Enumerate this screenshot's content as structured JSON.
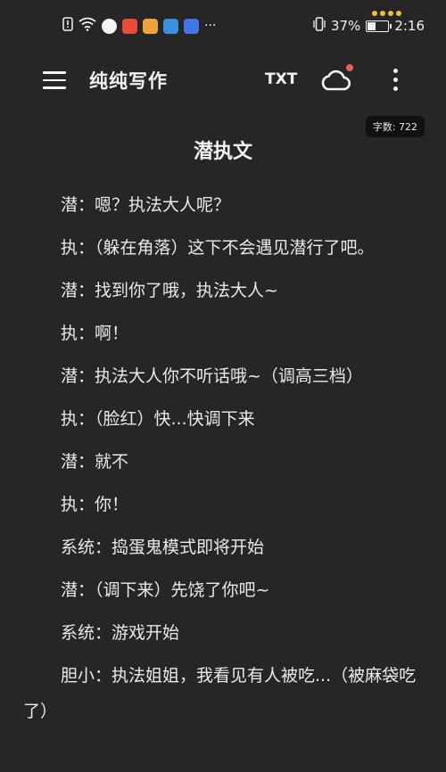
{
  "status_bar": {
    "time": "2:16",
    "battery_percent": "37%",
    "battery_level": 0.37,
    "left_icons": [
      "alert-icon",
      "wifi-icon",
      "app-icon",
      "app-icon",
      "app-icon",
      "app-icon",
      "app-icon",
      "more-notifications-icon"
    ],
    "more_glyph": "···"
  },
  "app_bar": {
    "title": "纯纯写作",
    "txt_label": "TXT",
    "menu_icon": "hamburger-menu-icon",
    "cloud_icon": "cloud-sync-icon",
    "more_icon": "more-vertical-icon"
  },
  "word_count": "字数: 722",
  "document": {
    "title": "潜执文",
    "paragraphs": [
      "潜：嗯？执法大人呢？",
      "执：（躲在角落）这下不会遇见潜行了吧。",
      "潜：找到你了哦，执法大人~",
      "执：啊！",
      "潜：执法大人你不听话哦~（调高三档）",
      "执：（脸红）快...快调下来",
      "潜：就不",
      "执：你！",
      "系统：捣蛋鬼模式即将开始",
      "潜：（调下来）先饶了你吧~",
      "系统：游戏开始",
      "胆小：执法姐姐，我看见有人被吃...（被麻袋吃了）"
    ]
  },
  "colors": {
    "background": "#262626",
    "text": "#e9e9e9",
    "badge": "#e8615a",
    "chip_bg": "#111111"
  }
}
